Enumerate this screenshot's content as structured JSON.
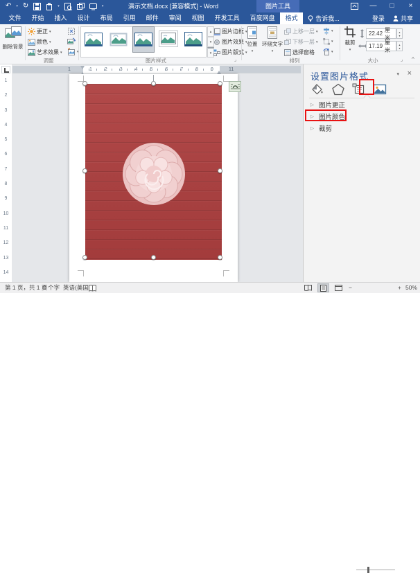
{
  "titlebar": {
    "title": "演示文档.docx [兼容模式] - Word",
    "contextual_tool": "图片工具"
  },
  "tabs": [
    "文件",
    "开始",
    "插入",
    "设计",
    "布局",
    "引用",
    "邮件",
    "审阅",
    "视图",
    "开发工具",
    "百度网盘",
    "格式"
  ],
  "tellme": "告诉我...",
  "account": {
    "sign_in": "登录",
    "share": "共享"
  },
  "ribbon": {
    "remove_background": "删除背景",
    "adjust": {
      "group_label": "调整",
      "corrections": "更正",
      "color": "颜色",
      "artistic_effects": "艺术效果"
    },
    "picture_styles": {
      "group_label": "图片样式",
      "border": "图片边框",
      "effects": "图片效果",
      "layout": "图片版式"
    },
    "arrange": {
      "group_label": "排列",
      "position": "位置",
      "wrap_text": "环绕文字",
      "bring_forward": "上移一层",
      "send_backward": "下移一层",
      "selection_pane": "选择窗格"
    },
    "size": {
      "group_label": "大小",
      "crop": "裁剪",
      "height_value": "22.42",
      "width_value": "17.19",
      "unit": "厘米"
    }
  },
  "rulers": {
    "h_left": "1",
    "h_numbers": [
      "1",
      "2",
      "3",
      "4",
      "5",
      "6",
      "7",
      "8",
      "9"
    ],
    "h_right": "11",
    "v_numbers": [
      "1",
      "2",
      "3",
      "4",
      "5",
      "6",
      "7",
      "8",
      "9",
      "10",
      "11",
      "12",
      "13",
      "14"
    ]
  },
  "pane": {
    "title": "设置图片格式",
    "sections": [
      "图片更正",
      "图片颜色",
      "裁剪"
    ]
  },
  "statusbar": {
    "page_info": "第 1 页，共 1 页",
    "word_count": "0 个字",
    "language": "英语(美国)",
    "zoom_out": "−",
    "zoom_in": "+",
    "zoom_level": "50%"
  },
  "glyphs": {
    "undo": "↶",
    "redo": "↻",
    "more": "▾",
    "caret": "▾",
    "caret_up": "▴",
    "expand": "▷",
    "dot": "·",
    "minimize": "—",
    "maximize": "□",
    "close": "×",
    "collapse_ribbon": "^",
    "dialog_launcher": "⌟"
  },
  "colors": {
    "title_bar": "#2b579a",
    "contextual_tab": "#466cb7",
    "annotation_red": "#e81212",
    "image_wood_red": "#ab4242",
    "rose_pink": "#f2d4d4"
  }
}
